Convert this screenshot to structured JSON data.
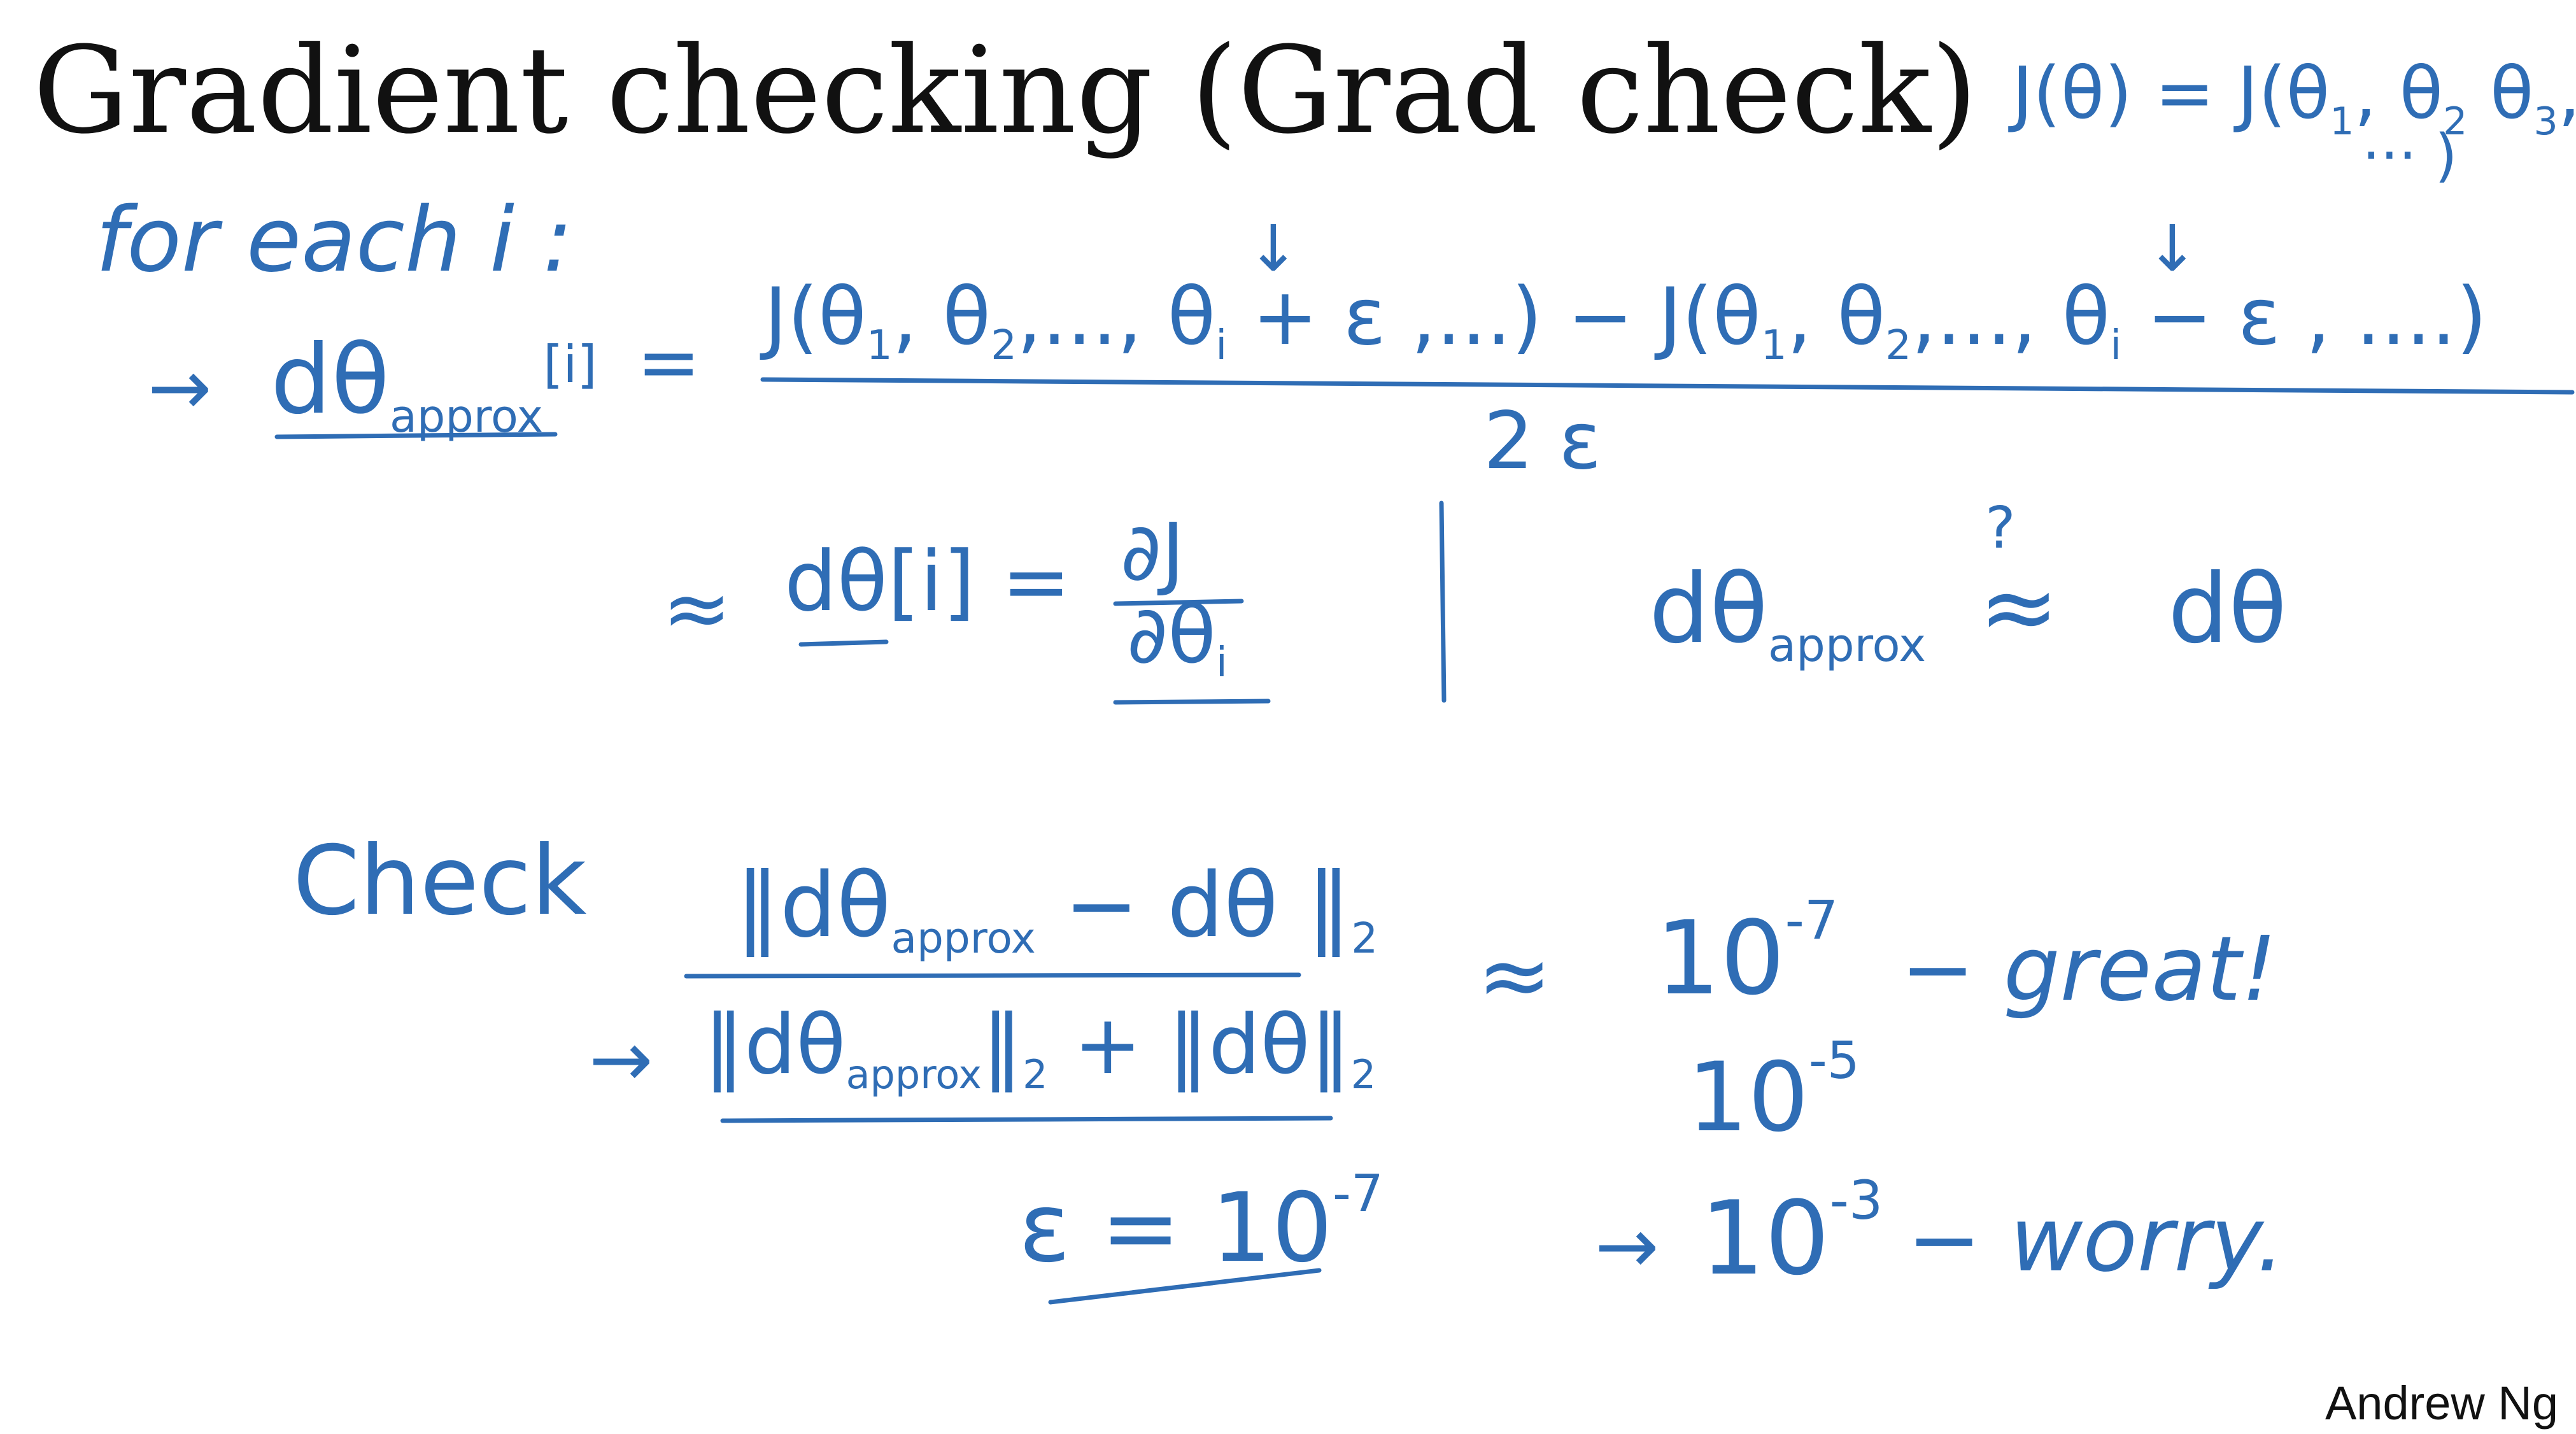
{
  "slide": {
    "title": "Gradient checking (Grad check)",
    "credit": "Andrew Ng"
  },
  "colors": {
    "ink": "#2f6db5",
    "title": "#111111",
    "background": "#ffffff"
  },
  "notes": {
    "cost_definition": {
      "lhs": "J(θ) = J(θ",
      "lhs_sub": "1",
      "mid": ", θ",
      "mid_sub": "2",
      "mid2": " θ",
      "mid2_sub": "3",
      "end": ",",
      "continuation": "··· )"
    },
    "loop_header": "for each i :",
    "approx_arrow": "→",
    "approx_lhs": "dθ",
    "approx_lhs_sub": "approx",
    "approx_lhs_index": "[i]",
    "equals": "=",
    "numerator": {
      "part1": "J(θ",
      "sub1": "1",
      "part2": ", θ",
      "sub2": "2",
      "part3": ",..., θ",
      "sub3": "i",
      "part4": " + ε ,...) − J(θ",
      "sub4": "1",
      "part5": ", θ",
      "sub5": "2",
      "part6": ",..., θ",
      "sub6": "i",
      "part7": " − ε , ....)"
    },
    "down_arrow": "↓",
    "denominator": "2 ε",
    "approx_symbol": "≈",
    "derivative_lhs": "dθ[i] =",
    "derivative_num": "∂J",
    "derivative_den": "∂θ",
    "derivative_den_sub": "i",
    "compare": {
      "left": "dθ",
      "left_sub": "approx",
      "relation": "≈",
      "question": "?",
      "right": "dθ"
    },
    "check": {
      "label": "Check",
      "numerator_open": "‖dθ",
      "numerator_sub": "approx",
      "numerator_mid": " − dθ ‖",
      "numerator_norm": "2",
      "arrow": "→",
      "denominator_open": "‖dθ",
      "denominator_sub": "approx",
      "denominator_close": "‖",
      "denominator_norm1": "2",
      "denominator_mid": " + ‖dθ‖",
      "denominator_norm2": "2",
      "epsilon_eq": "ε = 10",
      "epsilon_exp": "-7"
    },
    "results": {
      "approx": "≈",
      "row1_base": "10",
      "row1_exp": "-7",
      "row1_note": "− great!",
      "row2_base": "10",
      "row2_exp": "-5",
      "row3_arrow": "→",
      "row3_base": "10",
      "row3_exp": "-3",
      "row3_note": "− worry."
    }
  }
}
